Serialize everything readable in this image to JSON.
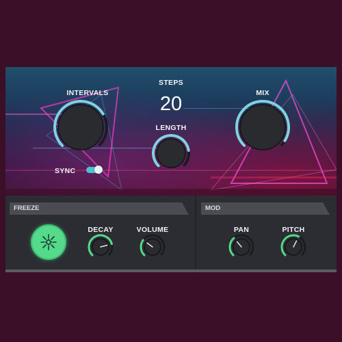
{
  "top": {
    "intervals_label": "INTERVALS",
    "steps_label": "STEPS",
    "steps_value": "20",
    "length_label": "LENGTH",
    "mix_label": "MIX",
    "sync_label": "SYNC",
    "sync_on": true,
    "knobs": {
      "intervals": 0.72,
      "length": 0.8,
      "mix": 0.95
    },
    "accent": "#7fd3e0"
  },
  "freeze": {
    "header": "FREEZE",
    "button_icon": "freeze-burst-icon",
    "decay_label": "DECAY",
    "volume_label": "VOLUME",
    "knobs": {
      "decay": 0.78,
      "volume": 0.3
    },
    "accent": "#55d98a"
  },
  "mod": {
    "header": "MOD",
    "pan_label": "PAN",
    "pitch_label": "PITCH",
    "knobs": {
      "pan": 0.35,
      "pitch": 0.6
    }
  }
}
